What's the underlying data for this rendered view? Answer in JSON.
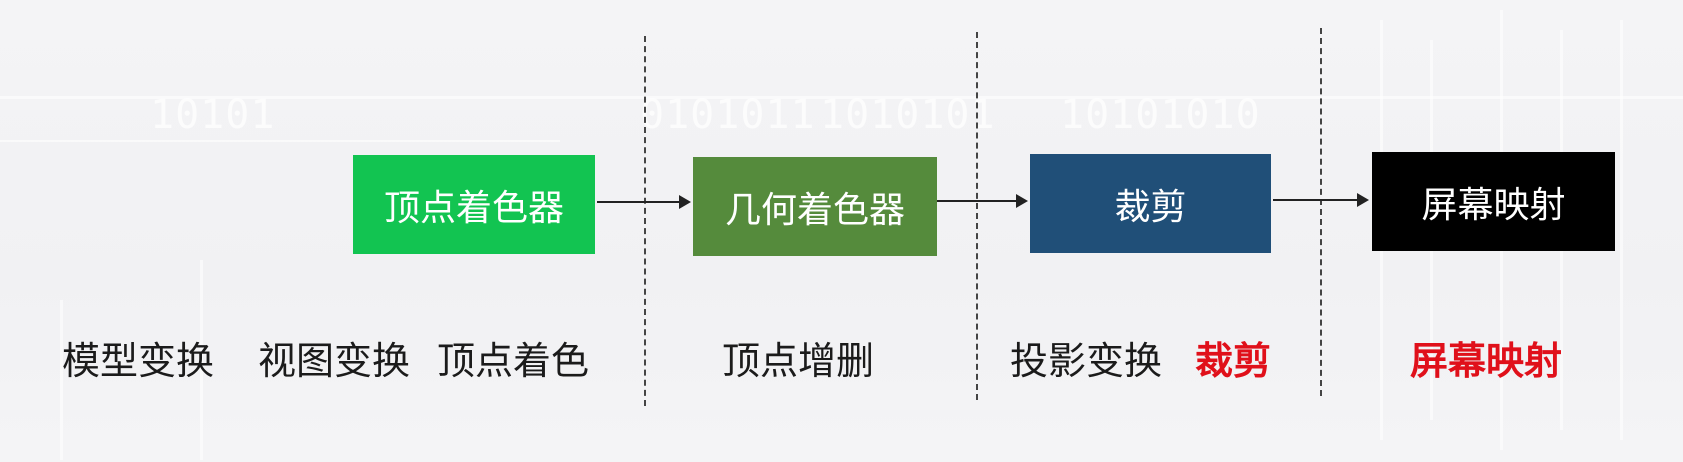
{
  "pipeline": {
    "stages": [
      {
        "label": "顶点着色器",
        "color": "#12c451"
      },
      {
        "label": "几何着色器",
        "color": "#558b3c"
      },
      {
        "label": "裁剪",
        "color": "#204f78"
      },
      {
        "label": "屏幕映射",
        "color": "#000000"
      }
    ]
  },
  "captions": {
    "model_transform": "模型变换",
    "view_transform": "视图变换",
    "vertex_shading": "顶点着色",
    "vertex_add_remove": "顶点增删",
    "projection_transform": "投影变换",
    "clipping": "裁剪",
    "screen_mapping": "屏幕映射"
  },
  "watermark": {
    "text_1": "10101",
    "text_2": "0101011",
    "text_3": "1010101",
    "text_4": "10101010"
  },
  "colors": {
    "highlight_red": "#e0101a",
    "divider": "#444444"
  }
}
